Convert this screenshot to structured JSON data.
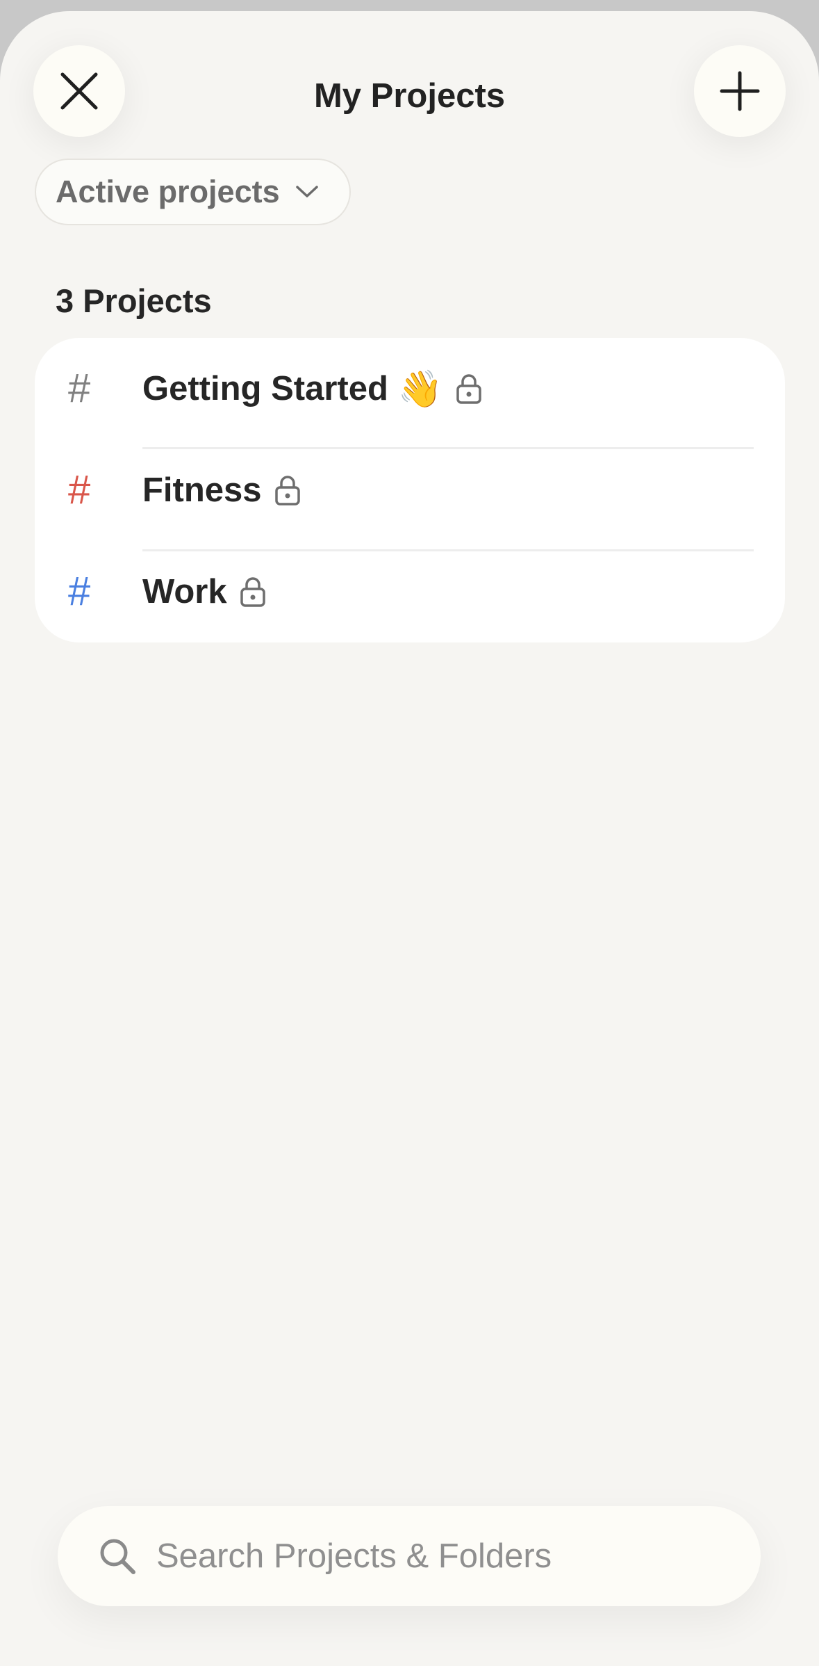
{
  "header": {
    "title": "My Projects",
    "close_icon": "close-icon",
    "add_icon": "plus-icon"
  },
  "filter": {
    "label": "Active projects",
    "icon": "chevron-down-icon"
  },
  "projects": {
    "count_label": "3 Projects",
    "items": [
      {
        "name": "Getting Started",
        "emoji": "👋",
        "hash": "#",
        "color": "#808080",
        "icon": "lock-icon"
      },
      {
        "name": "Fitness",
        "emoji": "",
        "hash": "#",
        "color": "#d9564a",
        "icon": "lock-icon"
      },
      {
        "name": "Work",
        "emoji": "",
        "hash": "#",
        "color": "#4a7fe0",
        "icon": "lock-icon"
      }
    ]
  },
  "search": {
    "placeholder": "Search Projects & Folders",
    "icon": "search-icon"
  }
}
